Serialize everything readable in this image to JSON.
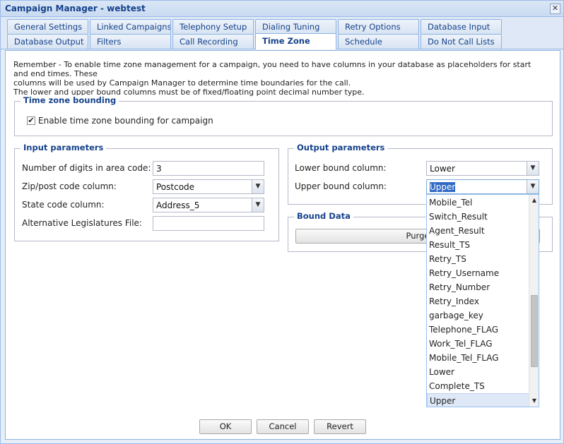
{
  "window": {
    "title": "Campaign Manager - webtest",
    "close_glyph": "✕"
  },
  "tabs": [
    {
      "label": "General Settings"
    },
    {
      "label": "Linked Campaigns"
    },
    {
      "label": "Telephony Setup"
    },
    {
      "label": "Dialing Tuning"
    },
    {
      "label": "Retry Options"
    },
    {
      "label": "Database Input"
    },
    {
      "label": "Database Output"
    },
    {
      "label": "Filters"
    },
    {
      "label": "Call Recording"
    },
    {
      "label": "Time Zone"
    },
    {
      "label": "Schedule"
    },
    {
      "label": "Do Not Call Lists"
    }
  ],
  "active_tab": "Time Zone",
  "notice": {
    "line1": "Remember - To enable time zone management for a campaign, you need to have columns in your database as placeholders for start and end times. These",
    "line2": "columns will be used by Campaign Manager to determine time boundaries for the call.",
    "line3": "The lower and upper bound columns must be of fixed/floating point decimal number type."
  },
  "tz_bounding": {
    "legend": "Time zone bounding",
    "enable_label": "Enable time zone bounding for campaign",
    "enabled": true,
    "check_glyph": "✔"
  },
  "input_params": {
    "legend": "Input parameters",
    "digits_label": "Number of digits in area code:",
    "digits_value": "3",
    "zip_label": "Zip/post code column:",
    "zip_value": "Postcode",
    "state_label": "State code column:",
    "state_value": "Address_5",
    "alt_label": "Alternative Legislatures File:",
    "alt_value": ""
  },
  "output_params": {
    "legend": "Output parameters",
    "lower_label": "Lower bound column:",
    "lower_value": "Lower",
    "upper_label": "Upper bound column:",
    "upper_value": "Upper"
  },
  "bound_data": {
    "legend": "Bound Data",
    "purge_label": "Purge"
  },
  "dropdown": {
    "items": [
      "Mobile_Tel",
      "Switch_Result",
      "Agent_Result",
      "Result_TS",
      "Retry_TS",
      "Retry_Username",
      "Retry_Number",
      "Retry_Index",
      "garbage_key",
      "Telephone_FLAG",
      "Work_Tel_FLAG",
      "Mobile_Tel_FLAG",
      "Lower",
      "Complete_TS",
      "Upper"
    ],
    "selected": "Upper"
  },
  "icons": {
    "combo_arrow": "▼",
    "scroll_up": "▲",
    "scroll_down": "▼"
  },
  "footer": {
    "ok_label": "OK",
    "cancel_label": "Cancel",
    "revert_label": "Revert"
  }
}
